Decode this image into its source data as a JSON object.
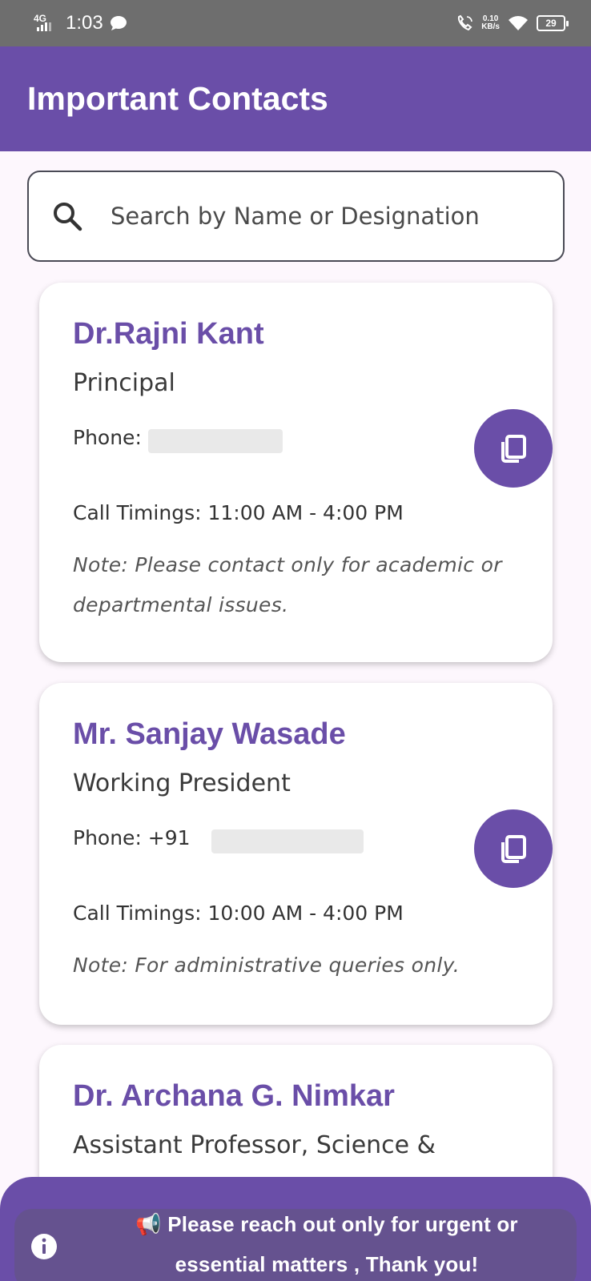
{
  "status_bar": {
    "network": "4G",
    "time": "1:03",
    "speed_value": "0.10",
    "speed_unit": "KB/s",
    "battery": "29"
  },
  "app_bar": {
    "title": "Important Contacts"
  },
  "search": {
    "placeholder": "Search by Name or Designation"
  },
  "contacts": [
    {
      "name": "Dr.Rajni Kant",
      "designation": "Principal",
      "phone_label": "Phone:",
      "timings": "Call Timings: 11:00 AM - 4:00 PM",
      "note": "Note: Please contact only for academic or departmental issues."
    },
    {
      "name": "Mr. Sanjay Wasade",
      "designation": "Working President",
      "phone_label": "Phone: +91",
      "timings": "Call Timings: 10:00 AM - 4:00 PM",
      "note": "Note: For administrative queries only."
    },
    {
      "name": "Dr. Archana G. Nimkar",
      "designation": "Assistant Professor, Science &"
    }
  ],
  "banner": {
    "text": "📢 Please reach out only for urgent or essential matters , Thank you!"
  },
  "icons": {
    "search": "search-icon",
    "copy": "copy-icon",
    "info": "info-icon",
    "megaphone": "megaphone-icon"
  },
  "colors": {
    "primary": "#6a4ea8",
    "status_bar": "#6e6e6e",
    "background": "#fdf7fd"
  }
}
